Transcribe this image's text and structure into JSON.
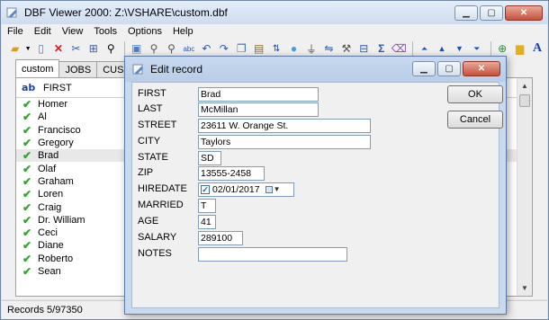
{
  "app": {
    "title": "DBF Viewer 2000: Z:\\VSHARE\\custom.dbf"
  },
  "menu": [
    "File",
    "Edit",
    "View",
    "Tools",
    "Options",
    "Help"
  ],
  "tabs": [
    "custom",
    "JOBS",
    "CUSLIST"
  ],
  "grid": {
    "type_icon": "ab",
    "column_header": "FIRST",
    "rows": [
      "Homer",
      "Al",
      "Francisco",
      "Gregory",
      "Brad",
      "Olaf",
      "Graham",
      "Loren",
      "Craig",
      "Dr. William",
      "Ceci",
      "Diane",
      "Roberto",
      "Sean"
    ],
    "selected_row": "Brad"
  },
  "status": {
    "records": "Records 5/97350"
  },
  "dialog": {
    "title": "Edit record",
    "ok_label": "OK",
    "cancel_label": "Cancel",
    "fields": {
      "first": {
        "label": "FIRST",
        "value": "Brad"
      },
      "last": {
        "label": "LAST",
        "value": "McMillan"
      },
      "street": {
        "label": "STREET",
        "value": "23611 W. Orange St."
      },
      "city": {
        "label": "CITY",
        "value": "Taylors"
      },
      "state": {
        "label": "STATE",
        "value": "SD"
      },
      "zip": {
        "label": "ZIP",
        "value": "13555-2458"
      },
      "hiredate": {
        "label": "HIREDATE",
        "value": "02/01/2017",
        "checked": true
      },
      "married": {
        "label": "MARRIED",
        "value": "T"
      },
      "age": {
        "label": "AGE",
        "value": "41"
      },
      "salary": {
        "label": "SALARY",
        "value": "289100"
      },
      "notes": {
        "label": "NOTES",
        "value": ""
      }
    }
  },
  "colors": {
    "title_bar": "#d6e3f4",
    "check_green": "#2da82d",
    "close_red": "#c7503a"
  },
  "icons": [
    "open-folder-icon",
    "new-file-icon",
    "delete-icon",
    "cut-icon",
    "structure-icon",
    "find-icon",
    "print-icon",
    "search-icon",
    "find-next-icon",
    "spell-icon",
    "undo-icon",
    "redo-icon",
    "copy-icon",
    "paste-icon",
    "sort-icon",
    "comment-icon",
    "filter-icon",
    "replace-icon",
    "grid-icon",
    "sum-icon",
    "clear-icon",
    "first-record-icon",
    "prev-record-icon",
    "next-record-icon",
    "last-record-icon",
    "help-globe-icon",
    "chat-icon",
    "font-icon"
  ]
}
